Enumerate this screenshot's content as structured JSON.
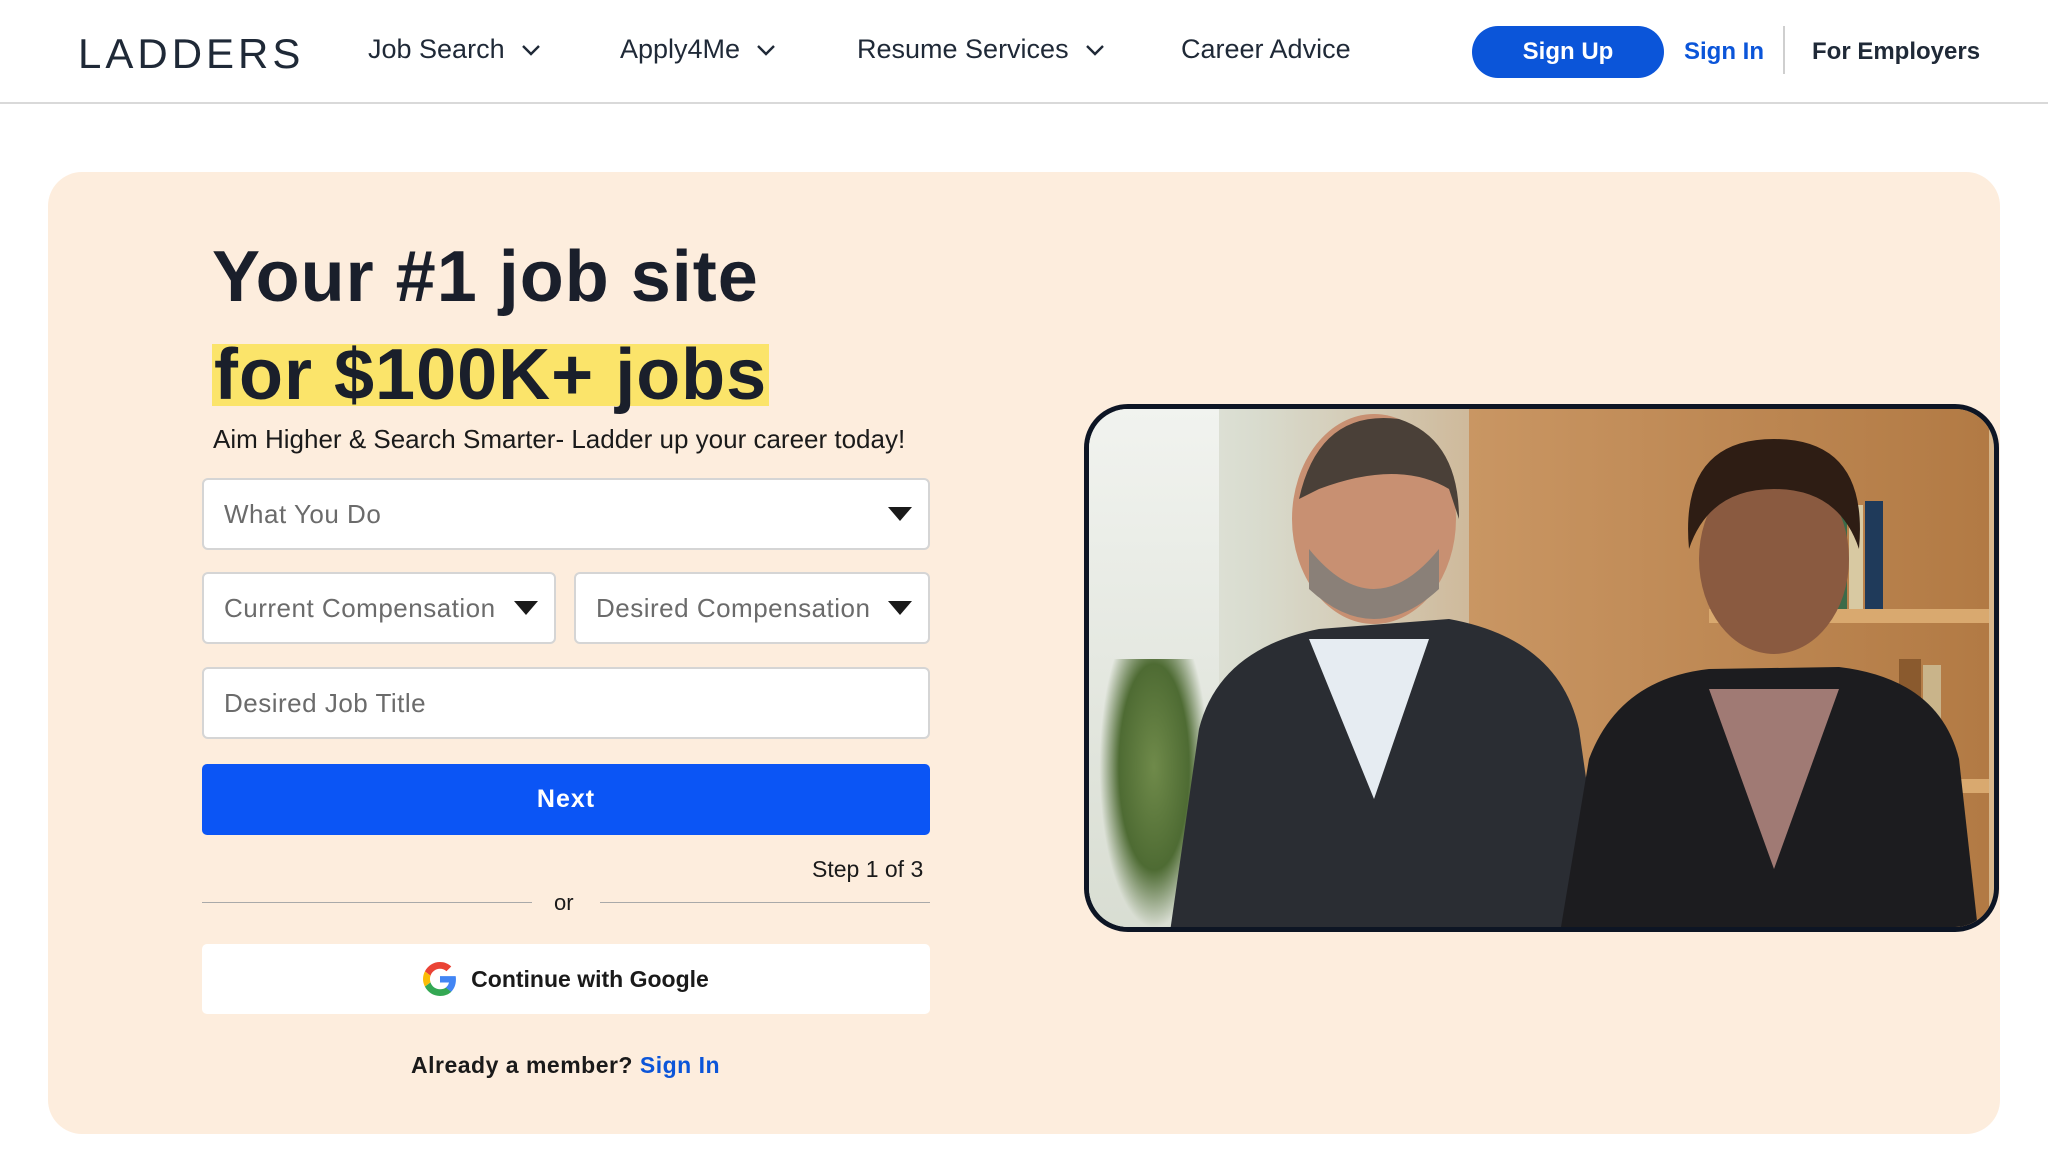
{
  "header": {
    "logo": "LADDERS",
    "nav": [
      {
        "label": "Job Search",
        "has_dropdown": true,
        "icon": "chevron-down-icon"
      },
      {
        "label": "Apply4Me",
        "has_dropdown": true,
        "icon": "chevron-down-icon"
      },
      {
        "label": "Resume Services",
        "has_dropdown": true,
        "icon": "chevron-down-icon"
      },
      {
        "label": "Career Advice",
        "has_dropdown": false
      }
    ],
    "sign_up": "Sign Up",
    "sign_in": "Sign In",
    "for_employers": "For Employers"
  },
  "hero": {
    "headline_line1": "Your #1 job site",
    "headline_line2": "for $100K+ jobs",
    "subtitle": "Aim Higher & Search Smarter- Ladder up your career today!",
    "form": {
      "what_you_do": "What You Do",
      "current_compensation": "Current Compensation",
      "desired_compensation": "Desired Compensation",
      "desired_job_title_placeholder": "Desired Job Title",
      "next_button": "Next",
      "step_text": "Step 1 of 3",
      "or_text": "or",
      "google_button": "Continue with Google",
      "member_prompt": "Already a member?",
      "member_sign_in": "Sign In"
    },
    "image_alt": "two-professionals-photo"
  },
  "colors": {
    "primary_blue": "#0b55f5",
    "link_blue": "#0b55d9",
    "hero_background": "#fdeddd",
    "highlight_yellow": "#fbe46a",
    "text_dark": "#1a1f2b"
  }
}
